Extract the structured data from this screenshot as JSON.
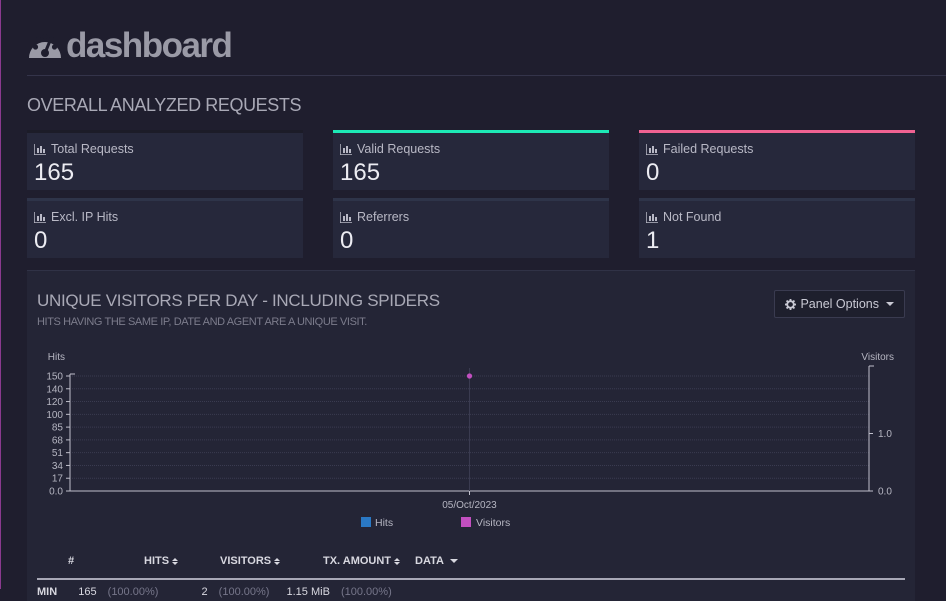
{
  "header": {
    "title": "dashboard",
    "icon": "dashboard-gauge-icon"
  },
  "section": {
    "title": "OVERALL ANALYZED REQUESTS"
  },
  "cards": [
    {
      "label": "Total Requests",
      "value": "165",
      "accent": "#1c1c28"
    },
    {
      "label": "Valid Requests",
      "value": "165",
      "accent": "#1de9b6"
    },
    {
      "label": "Failed Requests",
      "value": "0",
      "accent": "#f06292"
    },
    {
      "label": "Excl. IP Hits",
      "value": "0"
    },
    {
      "label": "Referrers",
      "value": "0"
    },
    {
      "label": "Not Found",
      "value": "1"
    }
  ],
  "panel": {
    "title": "UNIQUE VISITORS PER DAY - INCLUDING SPIDERS",
    "subtitle": "HITS HAVING THE SAME IP, DATE AND AGENT ARE A UNIQUE VISIT.",
    "options_label": "Panel Options",
    "table": {
      "headers": [
        "#",
        "HITS",
        "VISITORS",
        "TX. AMOUNT",
        "DATA"
      ],
      "peek_row": [
        "MIN",
        "165",
        "(100.00%)",
        "2",
        "(100.00%)",
        "1.15 MiB",
        "(100.00%)"
      ]
    }
  },
  "chart_data": {
    "type": "bar",
    "categories": [
      "05/Oct/2023"
    ],
    "series": [
      {
        "name": "Hits",
        "axis": "left",
        "values": [
          165
        ],
        "color": "#2a78c4"
      },
      {
        "name": "Visitors",
        "axis": "right",
        "values": [
          2
        ],
        "color": "#c24fc0"
      }
    ],
    "ylabel": "Hits",
    "y2label": "Visitors",
    "y_ticks": [
      "150",
      "140",
      "120",
      "100",
      "85",
      "68",
      "51",
      "34",
      "17",
      "0.0"
    ],
    "y2_ticks": [
      "1.0",
      "0.0"
    ],
    "legend_position": "bottom",
    "grid": true
  },
  "colors": {
    "accent_valid": "#1de9b6",
    "accent_failed": "#f06292",
    "background": "#1f1e2e",
    "panel": "#242536"
  }
}
